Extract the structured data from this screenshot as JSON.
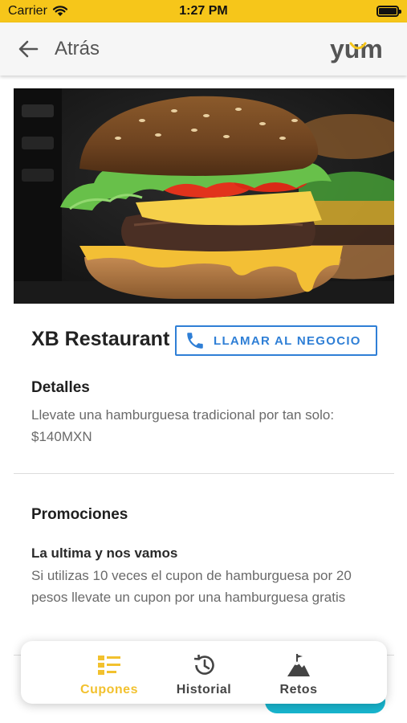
{
  "status_bar": {
    "carrier": "Carrier",
    "time": "1:27 PM",
    "background": "#f6c61a"
  },
  "app_bar": {
    "back_label": "Atrás",
    "back_icon": "arrow-left-icon",
    "logo_text": "yum",
    "logo_colors": {
      "text": "#555555",
      "accent": "#f6c61a"
    }
  },
  "hero": {
    "image_description": "burger-photo"
  },
  "restaurant": {
    "name": "XB Restaurant",
    "call_button_label": "LLAMAR AL NEGOCIO",
    "call_icon": "phone-icon",
    "accent": "#2f7fd6"
  },
  "details": {
    "title": "Detalles",
    "text": "Llevate una hamburguesa tradicional por tan solo: $140MXN"
  },
  "promotions": {
    "title": "Promociones",
    "items": [
      {
        "title": "La ultima y nos vamos",
        "text": "Si utilizas 10 veces el cupon de hamburguesa por 20 pesos llevate un cupon por una hamburguesa gratis"
      }
    ]
  },
  "bottom_nav": {
    "items": [
      {
        "label": "Cupones",
        "icon": "coupons-list-icon",
        "active": true
      },
      {
        "label": "Historial",
        "icon": "history-icon",
        "active": false
      },
      {
        "label": "Retos",
        "icon": "mountain-flag-icon",
        "active": false
      }
    ],
    "active_color": "#f2c12e"
  }
}
